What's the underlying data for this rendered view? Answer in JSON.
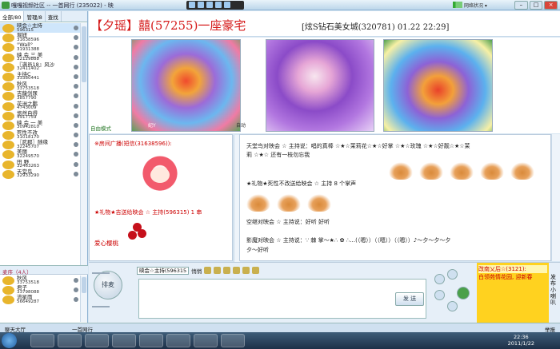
{
  "window": {
    "title": "嘎嘎视频社区 -- 一首网行 (235022) - 映",
    "net_status": "网络状况 ▾",
    "min": "–",
    "max": "□",
    "close": "×"
  },
  "left_tabs": {
    "users": "全部/80",
    "admins": "管理/8",
    "search": "查找"
  },
  "users": [
    {
      "name": "映会☆主持",
      "id": "596315"
    },
    {
      "name": "堀妞",
      "id": "31638596"
    },
    {
      "name": "°Wall°",
      "id": "31931388"
    },
    {
      "name": "映 会 三 美",
      "id": "32129888"
    },
    {
      "name": "『满员18』风沙",
      "id": "32411402"
    },
    {
      "name": "主持C",
      "id": "33380441"
    },
    {
      "name": "秋风",
      "id": "33753518"
    },
    {
      "name": "吉龍剑尿",
      "id": "3857790"
    },
    {
      "name": "花洲之鹏",
      "id": "4743009"
    },
    {
      "name": "悠然自得",
      "id": "4917759"
    },
    {
      "name": "映 会 一 美",
      "id": "30942810"
    },
    {
      "name": "死性不改",
      "id": "31018170"
    },
    {
      "name": "〖武郡〗随缘",
      "id": "32245707"
    },
    {
      "name": "美丽",
      "id": "32249570"
    },
    {
      "name": "田 野",
      "id": "32463263"
    },
    {
      "name": "天堂鸟",
      "id": "32933290"
    }
  ],
  "queue_header": "麦序（4人）",
  "queue": [
    {
      "name": "秋风",
      "id": "33753518"
    },
    {
      "name": "君子",
      "id": "33798088"
    },
    {
      "name": "流星雨",
      "id": "56649287"
    }
  ],
  "banner": {
    "main": "【夕瑶】囍(57255)一座豪宅",
    "sub": "[炫S钻石美女城(320781) 01.22 22:29]"
  },
  "video": {
    "label1": "纪Y",
    "label2": "自动",
    "mode": "自由模式"
  },
  "private_chat": {
    "header": "※房间广播(短信)",
    "sender": "※房间广播(短信(31638596)):",
    "gift": "★礼物★吉送给映会 ☆ 主持(596315) 1 串",
    "love": "爱心樱桃"
  },
  "public_chat": {
    "line1": "天堂鸟对映会 ☆ 主持说：唱的真棒 ☆★☆茉莉花☆★☆好掌 ☆★☆玫瑰 ☆★☆好靓☆★☆茉",
    "line1b": "莉 ☆★☆ 还有一枝勿忘我",
    "gift": "★礼物★死性不改送给映会 ☆ 主持 8 个掌声",
    "line2": "空继对映会 ☆ 主持说：好听 好听",
    "line3": "影魔对映会 ☆ 主持说：∵ 棘 掌～★∴ ✿ ∴…(（嗯））（（嗯））（（嗯））♪～夕～夕～夕",
    "line3b": "夕～好听"
  },
  "input": {
    "mic_label": "排麦",
    "target": "映会☆主持(596315",
    "private_check": "悄悄",
    "send": "发 送"
  },
  "announcement": {
    "header": "改南乂后☆(3121):",
    "body": "白领苑情花园, 迎新春"
  },
  "side_vertical": "发布小喇叭",
  "footer": {
    "lobby": "聊天大厅",
    "room": "一首网行",
    "report": "举报"
  },
  "clock": {
    "time": "22:36",
    "date": "2011/1/22"
  }
}
